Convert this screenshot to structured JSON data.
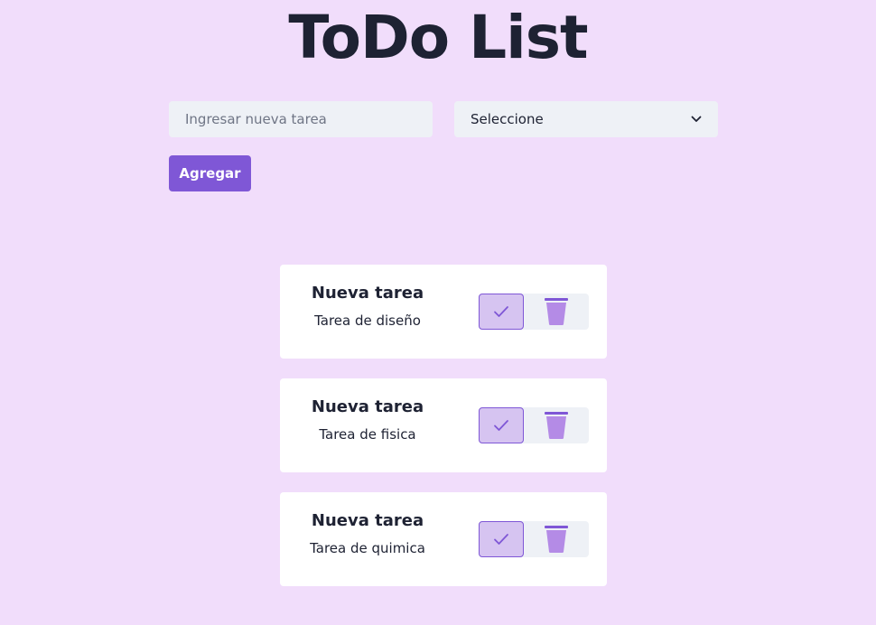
{
  "header": {
    "title": "ToDo List"
  },
  "form": {
    "task_placeholder": "Ingresar nueva tarea",
    "category_selected": "Seleccione",
    "add_label": "Agregar"
  },
  "tasks": [
    {
      "title": "Nueva tarea",
      "description": "Tarea de diseño"
    },
    {
      "title": "Nueva tarea",
      "description": "Tarea de fisica"
    },
    {
      "title": "Nueva tarea",
      "description": "Tarea de quimica"
    }
  ],
  "icons": {
    "check": "check-icon",
    "trash": "trash-icon",
    "dropdown": "chevron-down-icon"
  },
  "colors": {
    "background": "#f1ddfb",
    "accent": "#7f57d6",
    "accent_light": "#d6c4f1",
    "trash": "#b48be6",
    "input_bg": "#eef1f6",
    "text": "#1e2233"
  }
}
